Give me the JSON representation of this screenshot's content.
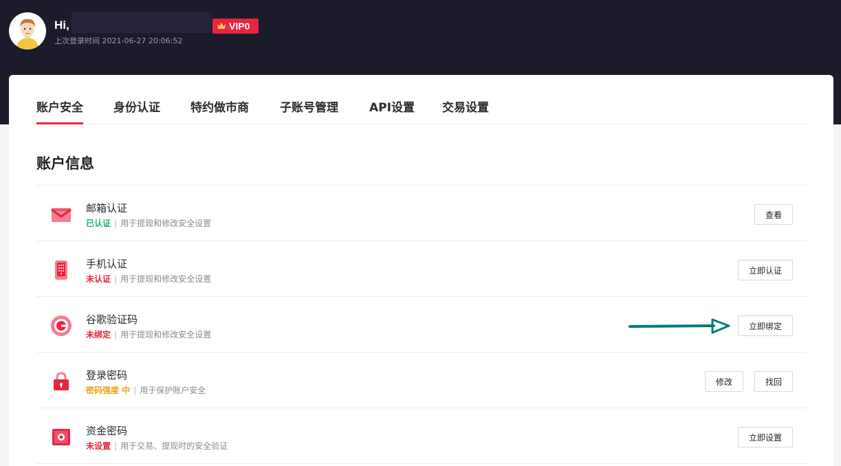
{
  "header": {
    "greeting": "Hi,",
    "vip_label": "VIP0",
    "last_login": "上次登录时间 2021-06-27 20:06:52"
  },
  "tabs": [
    {
      "label": "账户安全",
      "active": true
    },
    {
      "label": "身份认证"
    },
    {
      "label": "特约做市商"
    },
    {
      "label": "子账号管理"
    },
    {
      "label": "API设置"
    },
    {
      "label": "交易设置"
    }
  ],
  "section_title": "账户信息",
  "rows": [
    {
      "icon": "email-icon",
      "title": "邮箱认证",
      "status": "已认证",
      "desc": "用于提现和修改安全设置",
      "buttons": [
        "查看"
      ]
    },
    {
      "icon": "phone-icon",
      "title": "手机认证",
      "status": "未认证",
      "desc": "用于提现和修改安全设置",
      "buttons": [
        "立即认证"
      ]
    },
    {
      "icon": "google-authenticator-icon",
      "title": "谷歌验证码",
      "status": "未绑定",
      "desc": "用于提现和修改安全设置",
      "buttons": [
        "立即绑定"
      ]
    },
    {
      "icon": "lock-icon",
      "title": "登录密码",
      "status": "密码强度 中",
      "desc": "用于保护账户安全",
      "buttons": [
        "修改",
        "找回"
      ]
    },
    {
      "icon": "safe-icon",
      "title": "资金密码",
      "status": "未设置",
      "desc": "用于交易、提现时的安全验证",
      "buttons": [
        "立即设置"
      ]
    }
  ],
  "colors": {
    "accent": "#e8253f",
    "header_bg": "#1c1b2b",
    "status_green": "#22b26e",
    "status_orange": "#f0a019",
    "annotation_arrow": "#007c7a"
  }
}
